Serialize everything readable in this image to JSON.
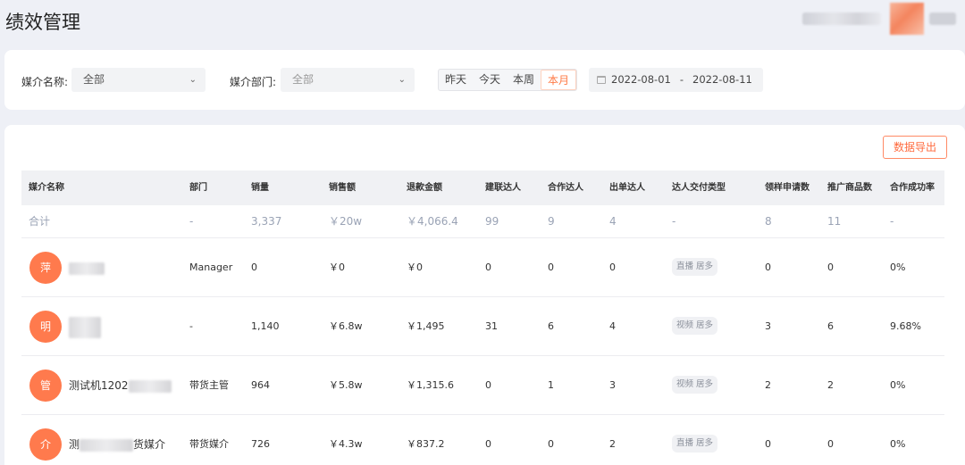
{
  "header": {
    "title": "绩效管理"
  },
  "filters": {
    "media_name_label": "媒介名称:",
    "media_name_value": "全部",
    "media_dept_label": "媒介部门:",
    "media_dept_value": "全部",
    "ranges": [
      "昨天",
      "今天",
      "本周",
      "本月"
    ],
    "active_range": "本月",
    "date_start": "2022-08-01",
    "date_sep": "-",
    "date_end": "2022-08-11"
  },
  "actions": {
    "export_label": "数据导出"
  },
  "table": {
    "columns": [
      "媒介名称",
      "部门",
      "销量",
      "销售额",
      "退款金额",
      "建联达人",
      "合作达人",
      "出单达人",
      "达人交付类型",
      "领样申请数",
      "推广商品数",
      "合作成功率"
    ],
    "total": [
      "合计",
      "-",
      "3,337",
      "￥20w",
      "￥4,066.4",
      "99",
      "9",
      "4",
      "-",
      "8",
      "11",
      "-"
    ],
    "rows": [
      {
        "avatar": "萍",
        "name_visible": "",
        "dept": "Manager",
        "sales": "0",
        "revenue": "￥0",
        "refund": "￥0",
        "contacted": "0",
        "cooperating": "0",
        "ordering": "0",
        "delivery_type": "直播 居多",
        "sample_requests": "0",
        "products": "0",
        "success_rate": "0%"
      },
      {
        "avatar": "明",
        "name_visible": "",
        "dept": "-",
        "sales": "1,140",
        "revenue": "￥6.8w",
        "refund": "￥1,495",
        "contacted": "31",
        "cooperating": "6",
        "ordering": "4",
        "delivery_type": "视频 居多",
        "sample_requests": "3",
        "products": "6",
        "success_rate": "9.68%"
      },
      {
        "avatar": "管",
        "name_visible": "测试机1202",
        "dept": "带货主管",
        "sales": "964",
        "revenue": "￥5.8w",
        "refund": "￥1,315.6",
        "contacted": "0",
        "cooperating": "1",
        "ordering": "3",
        "delivery_type": "视频 居多",
        "sample_requests": "2",
        "products": "2",
        "success_rate": "0%"
      },
      {
        "avatar": "介",
        "name_visible": "测",
        "name_suffix": "货媒介",
        "dept": "带货媒介",
        "sales": "726",
        "revenue": "￥4.3w",
        "refund": "￥837.2",
        "contacted": "0",
        "cooperating": "0",
        "ordering": "2",
        "delivery_type": "直播 居多",
        "sample_requests": "0",
        "products": "0",
        "success_rate": "0%"
      }
    ]
  },
  "colors": {
    "accent": "#ff7a45",
    "avatar_bg": "#ff7a4d",
    "page_bg": "#eef0f6"
  }
}
